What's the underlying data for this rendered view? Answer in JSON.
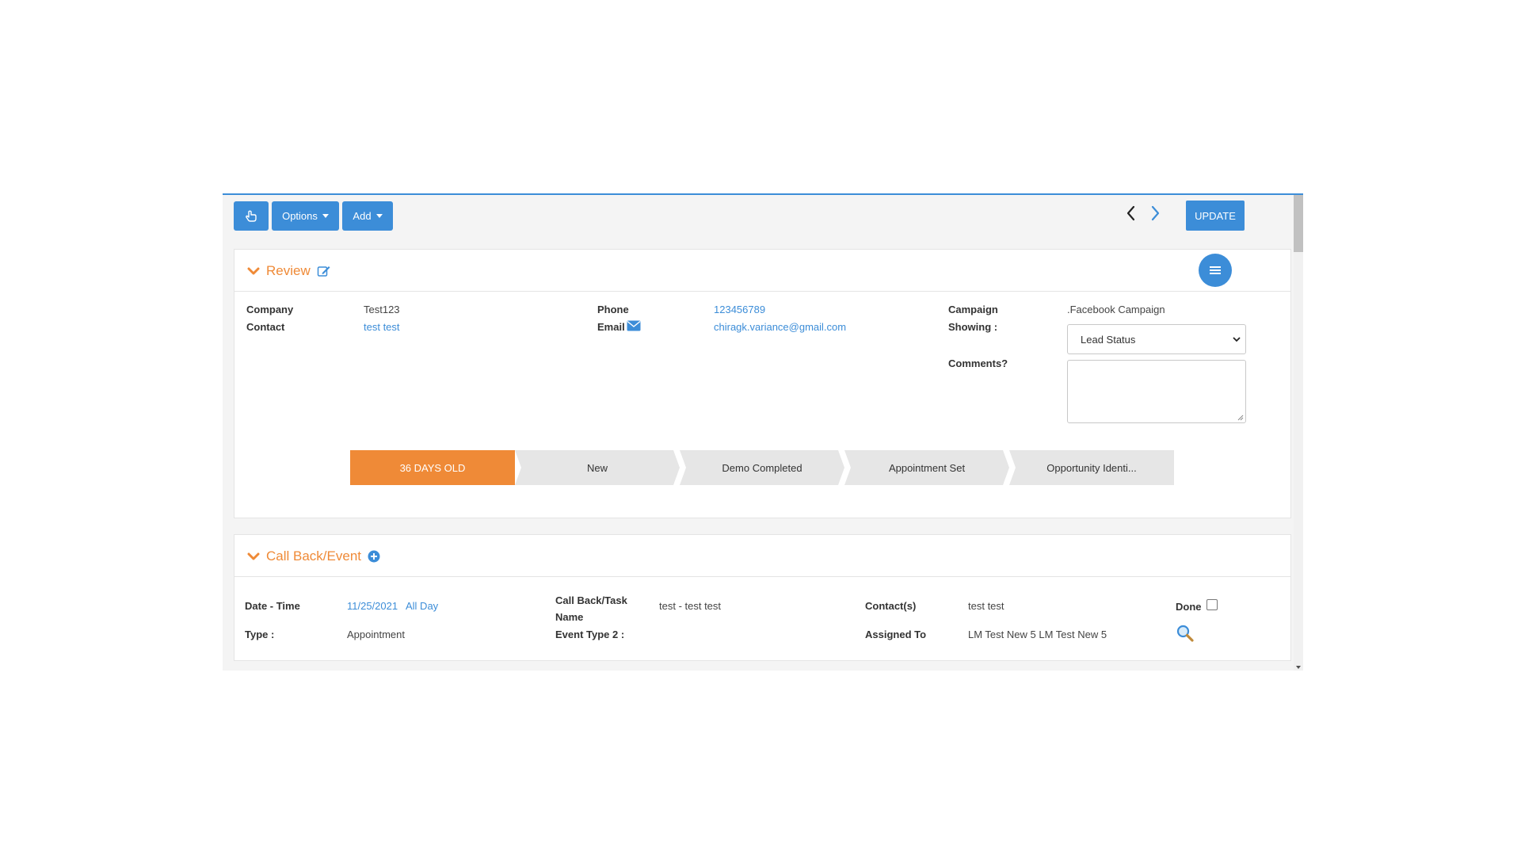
{
  "toolbar": {
    "options_label": "Options",
    "add_label": "Add",
    "update_label": "UPDATE"
  },
  "review": {
    "title": "Review",
    "company_label": "Company",
    "company_value": "Test123",
    "contact_label": "Contact",
    "contact_value": "test test",
    "phone_label": "Phone",
    "phone_value": "123456789",
    "email_label": "Email",
    "email_value": "chiragk.variance@gmail.com",
    "campaign_label": "Campaign",
    "campaign_value": ".Facebook Campaign",
    "showing_label": "Showing :",
    "showing_value": "Lead Status",
    "comments_label": "Comments?"
  },
  "stages": [
    {
      "label": "36 DAYS OLD"
    },
    {
      "label": "New"
    },
    {
      "label": "Demo Completed"
    },
    {
      "label": "Appointment Set"
    },
    {
      "label": "Opportunity Identi..."
    }
  ],
  "callback": {
    "title": "Call Back/Event",
    "date_time_label": "Date - Time",
    "date_value": "11/25/2021",
    "all_day_value": "All Day",
    "task_name_label": "Call Back/Task Name",
    "task_name_value": "test - test test",
    "contacts_label": "Contact(s)",
    "contacts_value": "test test",
    "done_label": "Done",
    "type_label": "Type :",
    "type_value": "Appointment",
    "event_type_label": "Event Type 2 :",
    "assigned_label": "Assigned To",
    "assigned_value": "LM Test New 5 LM Test New 5"
  },
  "colors": {
    "accent_blue": "#3c8dd8",
    "accent_orange": "#ef8a37"
  },
  "icons": [
    "hand-pointer-icon",
    "chevron-left-icon",
    "chevron-right-icon",
    "chevron-down-icon",
    "edit-icon",
    "menu-icon",
    "envelope-icon",
    "plus-circle-icon",
    "search-icon"
  ]
}
